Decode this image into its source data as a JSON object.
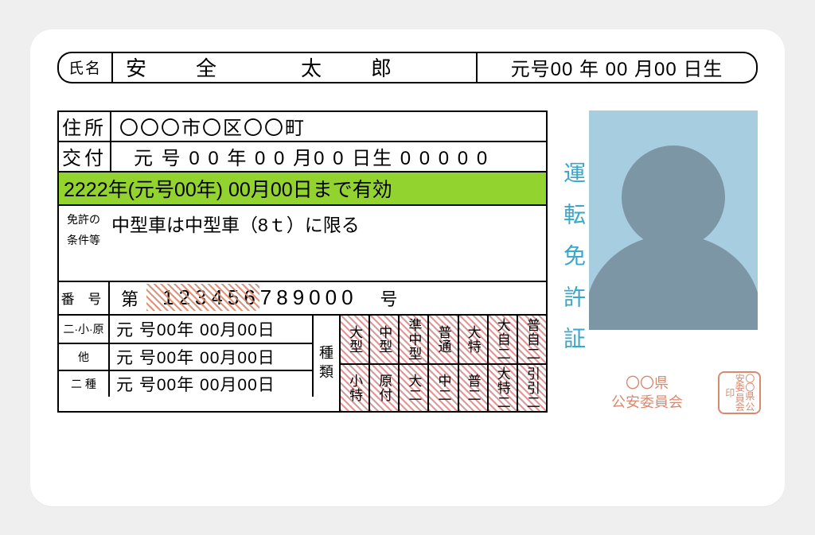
{
  "labels": {
    "name": "氏名",
    "address": "住所",
    "issue": "交付",
    "cond1": "免許の",
    "cond2": "条件等",
    "number": "番 号",
    "dai": "第",
    "go": "号",
    "category": "種類"
  },
  "name": "安　全　　太　郎",
  "dob": "元号00 年 00 月00 日生",
  "address": "〇〇〇市〇区〇〇町",
  "issue": "元 号 0 0 年 0 0 月0 0 日生 0 0 0 0 0",
  "expiry": "2222年(元号00年) 00月00日まで有効",
  "conditions": "中型車は中型車（8ｔ）に限る",
  "number": "123456789000",
  "dates": [
    {
      "label": "二·小·原",
      "value": "元 号00年 00月00日"
    },
    {
      "label": "他",
      "value": "元 号00年 00月00日"
    },
    {
      "label": "二 種",
      "value": "元 号00年 00月00日"
    }
  ],
  "categories_top": [
    "大型",
    "中型",
    "準中型",
    "普通",
    "大特",
    "大自二",
    "普自二"
  ],
  "categories_bottom": [
    "小特",
    "原付",
    "大二",
    "中二",
    "普二",
    "大特二",
    "引引二"
  ],
  "title_vertical": "運転免許証",
  "issuer_line1": "〇〇県",
  "issuer_line2": "公安委員会",
  "stamp": "〇〇県\n公安委\n員会印"
}
